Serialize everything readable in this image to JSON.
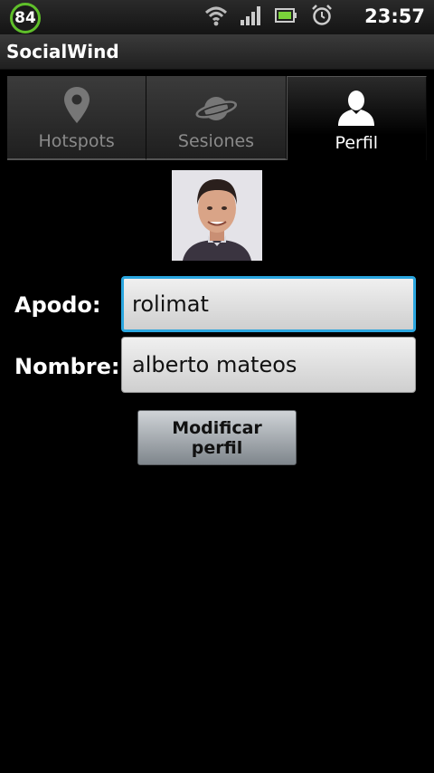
{
  "status_bar": {
    "battery_level": "84",
    "time": "23:57"
  },
  "app": {
    "title": "SocialWind"
  },
  "tabs": [
    {
      "label": "Hotspots",
      "icon": "location-pin-icon"
    },
    {
      "label": "Sesiones",
      "icon": "planet-icon"
    },
    {
      "label": "Perfil",
      "icon": "user-icon",
      "selected": true
    }
  ],
  "profile": {
    "nickname_label": "Apodo:",
    "nickname_value": "rolimat",
    "name_label": "Nombre:",
    "name_value": "alberto mateos",
    "submit_label": "Modificar perfil"
  },
  "colors": {
    "focus": "#2aa6df",
    "battery_ring": "#5fbf2a"
  }
}
